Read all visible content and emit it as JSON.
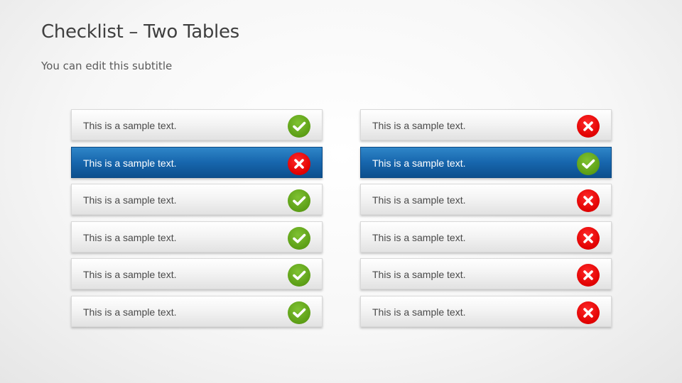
{
  "slide": {
    "title": "Checklist – Two Tables",
    "subtitle": "You can edit this subtitle"
  },
  "colors": {
    "highlight": "#1766ad",
    "check": "#5c9e16",
    "cross": "#e00000"
  },
  "tables": [
    {
      "rows": [
        {
          "text": "This is a sample text.",
          "status": "check-icon",
          "highlight": false
        },
        {
          "text": "This is a sample text.",
          "status": "cross-icon",
          "highlight": true
        },
        {
          "text": "This is a sample text.",
          "status": "check-icon",
          "highlight": false
        },
        {
          "text": "This is a sample text.",
          "status": "check-icon",
          "highlight": false
        },
        {
          "text": "This is a sample text.",
          "status": "check-icon",
          "highlight": false
        },
        {
          "text": "This is a sample text.",
          "status": "check-icon",
          "highlight": false
        }
      ]
    },
    {
      "rows": [
        {
          "text": "This is a sample text.",
          "status": "cross-icon",
          "highlight": false
        },
        {
          "text": "This is a sample text.",
          "status": "check-icon",
          "highlight": true
        },
        {
          "text": "This is a sample text.",
          "status": "cross-icon",
          "highlight": false
        },
        {
          "text": "This is a sample text.",
          "status": "cross-icon",
          "highlight": false
        },
        {
          "text": "This is a sample text.",
          "status": "cross-icon",
          "highlight": false
        },
        {
          "text": "This is a sample text.",
          "status": "cross-icon",
          "highlight": false
        }
      ]
    }
  ]
}
